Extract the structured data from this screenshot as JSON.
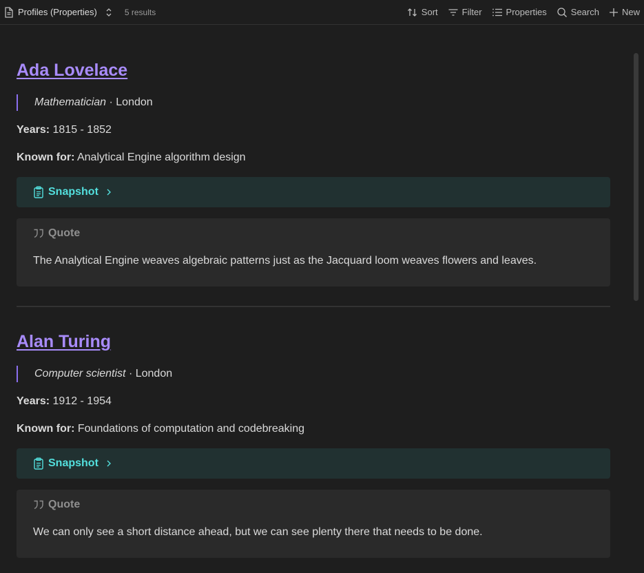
{
  "toolbar": {
    "view_name": "Profiles (Properties)",
    "results": "5 results",
    "sort_label": "Sort",
    "filter_label": "Filter",
    "properties_label": "Properties",
    "search_label": "Search",
    "new_label": "New"
  },
  "profiles": [
    {
      "name": "Ada Lovelace",
      "role": "Mathematician",
      "city_suffix": " · London",
      "years_label": "Years:",
      "years": " 1815 - 1852",
      "known_label": "Known for:",
      "known": " Analytical Engine algorithm design",
      "snapshot_label": "Snapshot",
      "quote_label": "Quote",
      "quote": "The Analytical Engine weaves algebraic patterns just as the Jacquard loom weaves flowers and leaves."
    },
    {
      "name": "Alan Turing",
      "role": "Computer scientist",
      "city_suffix": " · London",
      "years_label": "Years:",
      "years": " 1912 - 1954",
      "known_label": "Known for:",
      "known": " Foundations of computation and codebreaking",
      "snapshot_label": "Snapshot",
      "quote_label": "Quote",
      "quote": "We can only see a short distance ahead, but we can see plenty there that needs to be done."
    }
  ],
  "colors": {
    "background": "#1e1e1e",
    "title_link": "#a88bfa",
    "snapshot_accent": "#53dfdd",
    "snapshot_bg": "#213131",
    "quote_bg": "#2a2a2a"
  }
}
